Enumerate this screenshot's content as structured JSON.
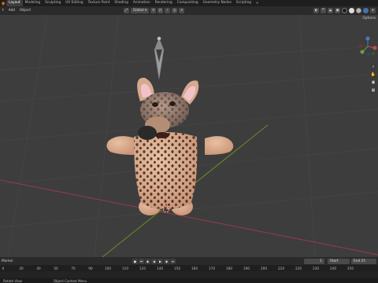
{
  "workspaces": {
    "tabs": [
      "Layout",
      "Modeling",
      "Sculpting",
      "UV Editing",
      "Texture Paint",
      "Shading",
      "Animation",
      "Rendering",
      "Compositing",
      "Geometry Nodes",
      "Scripting"
    ],
    "active": "Layout",
    "add_label": "+"
  },
  "header": {
    "menu": [
      "t",
      "Add",
      "Object"
    ],
    "orientation_label": "Global"
  },
  "options_label": "Options",
  "timeline": {
    "marker_label": "Marker",
    "current_frame": "1",
    "start_label": "Start",
    "start_value": "1",
    "end_label": "End",
    "end_value": "25",
    "ruler_ticks": [
      "0",
      "20",
      "40",
      "50",
      "70",
      "90",
      "100",
      "110",
      "120",
      "140",
      "150",
      "160",
      "170",
      "180",
      "190",
      "200",
      "210",
      "220",
      "230",
      "240",
      "250"
    ]
  },
  "status": {
    "left": "Rotate View",
    "middle": "Object Context Menu"
  },
  "colors": {
    "viewport_bg": "#3d3d3d",
    "grid_line": "#4a4a4a",
    "axis_x": "#9a3a4a",
    "axis_y": "#6b8e23",
    "accent": "#4772b3"
  },
  "icons": [
    "blender-logo-icon",
    "cursor-icon",
    "magnet-icon",
    "search-icon",
    "hand-icon",
    "camera-icon",
    "grid-icon",
    "play-icon",
    "jump-start-icon",
    "jump-end-icon"
  ]
}
